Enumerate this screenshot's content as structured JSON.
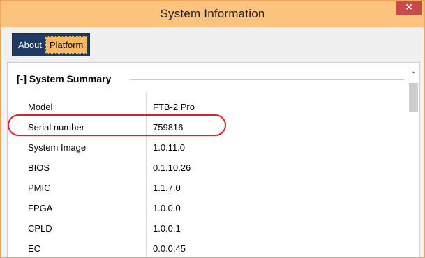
{
  "window": {
    "title": "System Information",
    "close_label": "×"
  },
  "tabs": [
    {
      "label": "About",
      "active": false
    },
    {
      "label": "Platform",
      "active": true
    }
  ],
  "summary": {
    "header": "[-] System Summary",
    "rows": [
      {
        "label": "Model",
        "value": "FTB-2 Pro"
      },
      {
        "label": "Serial number",
        "value": "759816",
        "highlighted": true
      },
      {
        "label": "System Image",
        "value": "1.0.11.0"
      },
      {
        "label": "BIOS",
        "value": "0.1.10.26"
      },
      {
        "label": "PMIC",
        "value": "1.1.7.0"
      },
      {
        "label": "FPGA",
        "value": "1.0.0.0"
      },
      {
        "label": "CPLD",
        "value": "1.0.0.1"
      },
      {
        "label": "EC",
        "value": "0.0.0.45"
      }
    ]
  },
  "colors": {
    "titlebar": "#fcc37f",
    "close_button": "#c74b4b",
    "tab_group_bg": "#203a63",
    "active_tab_bg": "#f9b95c",
    "highlight_outline": "#d8232a"
  },
  "icons": {
    "scroll_up": "chevron-up-icon"
  }
}
